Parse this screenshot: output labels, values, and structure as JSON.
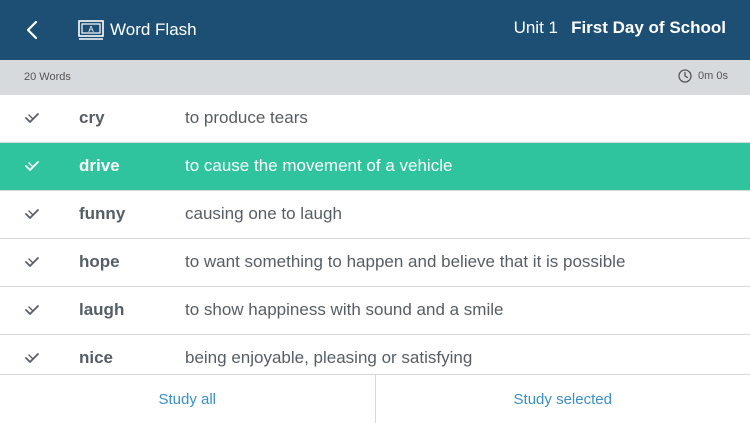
{
  "header": {
    "app_title": "Word Flash",
    "unit": "Unit 1",
    "lesson_title": "First Day of School"
  },
  "subheader": {
    "word_count": "20 Words",
    "timer": "0m 0s"
  },
  "words": [
    {
      "word": "cry",
      "definition": "to produce tears",
      "selected": false
    },
    {
      "word": "drive",
      "definition": "to cause the movement of a vehicle",
      "selected": true
    },
    {
      "word": "funny",
      "definition": "causing one to laugh",
      "selected": false
    },
    {
      "word": "hope",
      "definition": "to want something to happen and believe that it is possible",
      "selected": false
    },
    {
      "word": "laugh",
      "definition": "to show happiness with sound and a smile",
      "selected": false
    },
    {
      "word": "nice",
      "definition": "being enjoyable, pleasing or satisfying",
      "selected": false
    }
  ],
  "footer": {
    "study_all": "Study all",
    "study_selected": "Study selected"
  },
  "colors": {
    "header_bg": "#1c4f73",
    "selected_row": "#2fc49e",
    "link": "#3b8fc6"
  }
}
